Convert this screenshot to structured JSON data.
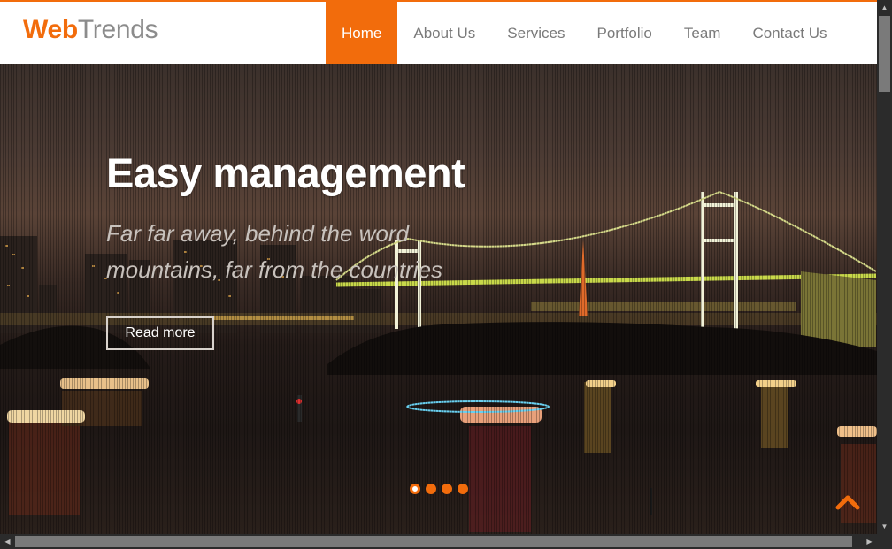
{
  "brand": {
    "name_part1": "Web",
    "name_part2": "Trends",
    "accent_color": "#f26c0c"
  },
  "nav": {
    "items": [
      {
        "label": "Home",
        "active": true
      },
      {
        "label": "About Us",
        "active": false
      },
      {
        "label": "Services",
        "active": false
      },
      {
        "label": "Portfolio",
        "active": false
      },
      {
        "label": "Team",
        "active": false
      },
      {
        "label": "Contact Us",
        "active": false
      }
    ]
  },
  "hero": {
    "title": "Easy management",
    "subtitle": "Far far away, behind the word mountains, far from the countries",
    "button_label": "Read more",
    "background": "night city bridge over bay with boats",
    "slides_count": 4,
    "active_slide": 1
  },
  "icons": {
    "back_to_top": "chevron-up-icon"
  }
}
